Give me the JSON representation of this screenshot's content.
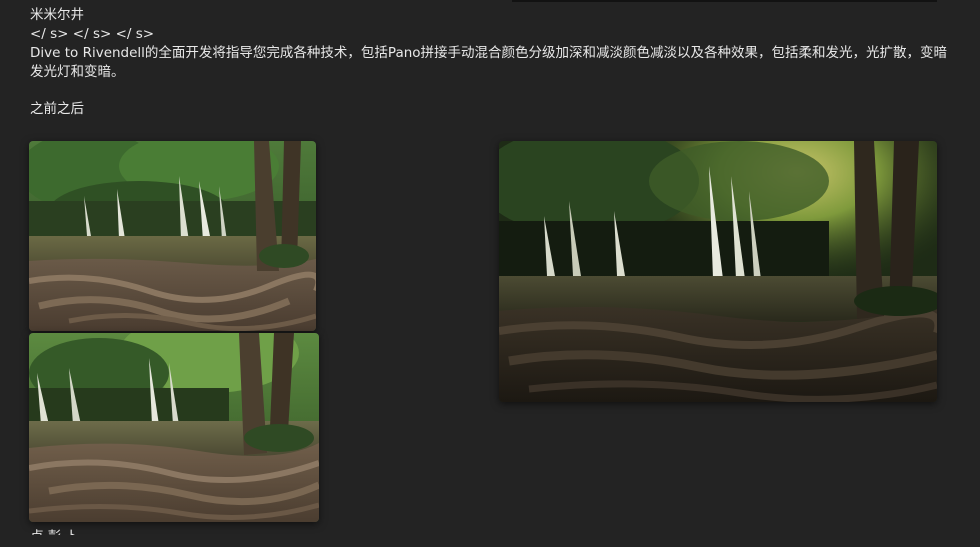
{
  "post": {
    "title": "米米尔井",
    "tags_line": "</ s> </ s> </ s>",
    "description": "Dive to Rivendell的全面开发将指导您完成各种技术，包括Pano拼接手动混合颜色分级加深和减淡颜色减淡以及各种效果，包括柔和发光，光扩散，变暗发光灯和变暗。",
    "before_after_label": "之前之后",
    "next_line_fragment": "卢 彭 卜"
  },
  "images": [
    {
      "subject": "waterfall-before-1"
    },
    {
      "subject": "waterfall-before-2"
    },
    {
      "subject": "waterfall-after"
    }
  ]
}
